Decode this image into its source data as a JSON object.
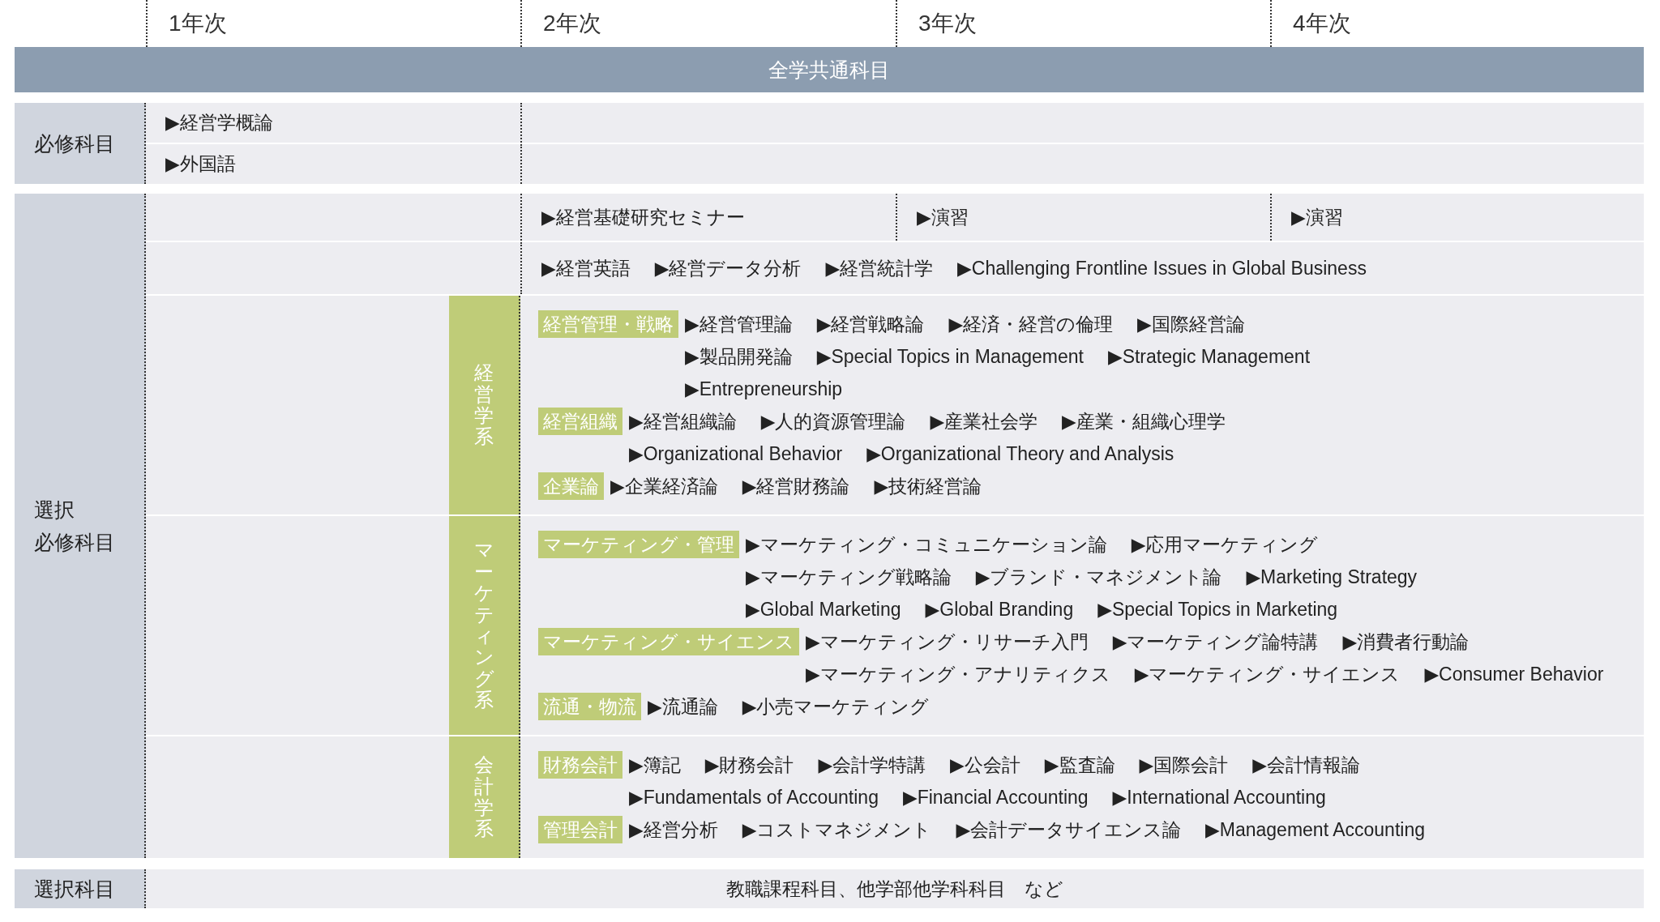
{
  "years": [
    "1年次",
    "2年次",
    "3年次",
    "4年次"
  ],
  "banner": "全学共通科目",
  "required": {
    "label": "必修科目",
    "rows": [
      "▶経営学概論",
      "▶外国語"
    ]
  },
  "elective_required": {
    "label_lines": [
      "選択",
      "必修科目"
    ],
    "seminar_row": [
      "▶経営基礎研究セミナー",
      "▶演習",
      "▶演習"
    ],
    "common_courses": [
      "▶経営英語",
      "▶経営データ分析",
      "▶経営統計学",
      "▶Challenging Frontline Issues in Global Business"
    ],
    "fields": [
      {
        "name": "経営学系",
        "subgroups": [
          {
            "tag": "経営管理・戦略",
            "lines": [
              [
                "▶経営管理論",
                "▶経営戦略論",
                "▶経済・経営の倫理",
                "▶国際経営論"
              ],
              [
                "▶製品開発論",
                "▶Special Topics in Management",
                "▶Strategic Management"
              ],
              [
                "▶Entrepreneurship"
              ]
            ]
          },
          {
            "tag": "経営組織",
            "lines": [
              [
                "▶経営組織論",
                "▶人的資源管理論",
                "▶産業社会学",
                "▶産業・組織心理学"
              ],
              [
                "▶Organizational Behavior",
                "▶Organizational Theory and Analysis"
              ]
            ]
          },
          {
            "tag": "企業論",
            "lines": [
              [
                "▶企業経済論",
                "▶経営財務論",
                "▶技術経営論"
              ]
            ]
          }
        ]
      },
      {
        "name": "マーケティング系",
        "subgroups": [
          {
            "tag": "マーケティング・管理",
            "lines": [
              [
                "▶マーケティング・コミュニケーション論",
                "▶応用マーケティング"
              ],
              [
                "▶マーケティング戦略論",
                "▶ブランド・マネジメント論",
                "▶Marketing Strategy"
              ],
              [
                "▶Global Marketing",
                "▶Global Branding",
                "▶Special Topics in Marketing"
              ]
            ]
          },
          {
            "tag": "マーケティング・サイエンス",
            "lines": [
              [
                "▶マーケティング・リサーチ入門",
                "▶マーケティング論特講",
                "▶消費者行動論"
              ],
              [
                "▶マーケティング・アナリティクス",
                "▶マーケティング・サイエンス",
                "▶Consumer Behavior"
              ]
            ]
          },
          {
            "tag": "流通・物流",
            "lines": [
              [
                "▶流通論",
                "▶小売マーケティング"
              ]
            ]
          }
        ]
      },
      {
        "name": "会計学系",
        "subgroups": [
          {
            "tag": "財務会計",
            "lines": [
              [
                "▶簿記",
                "▶財務会計",
                "▶会計学特講",
                "▶公会計",
                "▶監査論",
                "▶国際会計",
                "▶会計情報論"
              ],
              [
                "▶Fundamentals of Accounting",
                "▶Financial Accounting",
                "▶International Accounting"
              ]
            ]
          },
          {
            "tag": "管理会計",
            "lines": [
              [
                "▶経営分析",
                "▶コストマネジメント",
                "▶会計データサイエンス論",
                "▶Management Accounting"
              ]
            ]
          }
        ]
      }
    ]
  },
  "elective": {
    "label": "選択科目",
    "text": "教職課程科目、他学部他学科科目　など"
  }
}
